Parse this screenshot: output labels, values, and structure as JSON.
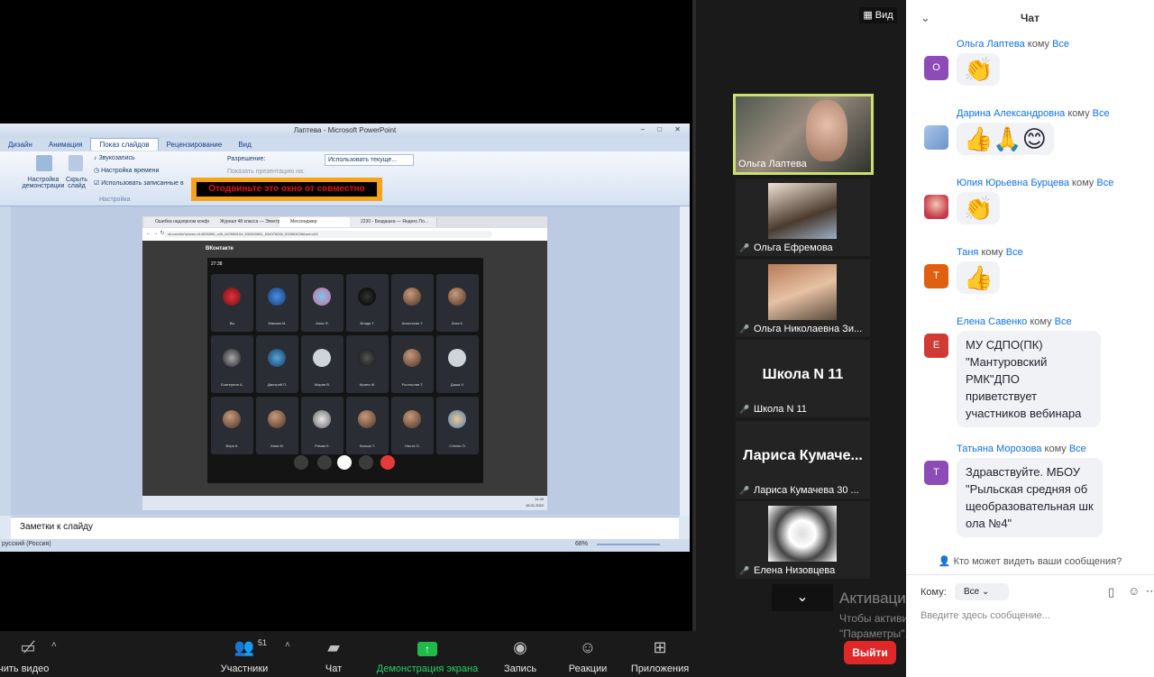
{
  "view_button": "Вид",
  "ppt": {
    "title": "Лаптева - Microsoft PowerPoint",
    "tabs": [
      "Дизайн",
      "Анимация",
      "Показ слайдов",
      "Рецензирование",
      "Вид"
    ],
    "active_tab": "Показ слайдов",
    "ribbon": {
      "setup_show": "Настройка демонстрации",
      "hide_slide": "Скрыть слайд",
      "record": "Звукозапись",
      "rehearse": "Настройка времени",
      "use_timings": "Использовать записанные в",
      "resolution_label": "Разрешение:",
      "resolution_value": "Использовать текуще...",
      "show_on": "Показать презентацию на:",
      "group_label": "Настройка"
    },
    "warning": "Отодвиньте это окно от совместно",
    "notes_placeholder": "Заметки к слайду",
    "status_lang": "русский (Россия)",
    "zoom": "68%"
  },
  "browser": {
    "tabs": [
      "Ошибка надзорном конфере...",
      "Журнал 48 класса — Электрон...",
      "Мессенджер",
      "2230 - Бездашка — Яндекс.По..."
    ],
    "active_tab": 2,
    "url": "vk.com/im?peers=c14526599_c45_547658104_532300591_534378245_533563028&sel=c53",
    "vk_logo": "ВКонтакте",
    "time": "27:38",
    "call_tiles": [
      "Вы",
      "Максим М.",
      "Анна Ф.",
      "Влада Т.",
      "Анастасия Т.",
      "Катя К.",
      "Екатерина А.",
      "Дмитрий П.",
      "Мария В.",
      "Ирина Ж.",
      "Ростислав Т.",
      "Даша Х.",
      "Вера К.",
      "Анна М.",
      "Роман К.",
      "Ксюша Т.",
      "Настя О.",
      "Степан П."
    ],
    "clock": "11:40",
    "date": "15.01.2022"
  },
  "gallery": {
    "tiles": [
      {
        "name": "Ольга Лаптева",
        "big": ""
      },
      {
        "name": "Ольга Ефремова",
        "big": ""
      },
      {
        "name": "Ольга Николаевна Зи...",
        "big": ""
      },
      {
        "name": "Школа N 11",
        "big": "Школа N 11"
      },
      {
        "name": "Лариса Кумачева 30 ...",
        "big": "Лариса  Кумаче..."
      },
      {
        "name": "Елена Низовцева",
        "big": ""
      }
    ]
  },
  "toolbar": {
    "video": "чить видео",
    "participants": "Участники",
    "participants_count": "51",
    "chat": "Чат",
    "share": "Демонстрация экрана",
    "record": "Запись",
    "reactions": "Реакции",
    "apps": "Приложения",
    "leave": "Выйти"
  },
  "watermark": {
    "line1": "Активация Windows",
    "line2": "Чтобы активировать Windows, перейдите в раздел \"Параметры\"."
  },
  "chat": {
    "title": "Чат",
    "messages": [
      {
        "sender": "Ольга Лаптева",
        "to_word": "кому",
        "to": "Все",
        "avatar": "О",
        "avatar_color": "#8c4bb7",
        "text": "👏"
      },
      {
        "sender": "Дарина Александровна",
        "to_word": "кому",
        "to": "Все",
        "avatar": "",
        "avatar_color": "#7fa7d8",
        "text": "👍🙏😊"
      },
      {
        "sender": "Юлия Юрьевна Бурцева",
        "to_word": "кому",
        "to": "Все",
        "avatar": "",
        "avatar_color": "#e0a3a3",
        "text": "👏"
      },
      {
        "sender": "Таня",
        "to_word": "кому",
        "to": "Все",
        "avatar": "Т",
        "avatar_color": "#e0600f",
        "text": "👍"
      },
      {
        "sender": "Елена Савенко",
        "to_word": "кому",
        "to": "Все",
        "avatar": "Е",
        "avatar_color": "#d13b36",
        "text": "МУ СДПО(ПК) \"Мантуровский РМК\"ДПО приветствует участников вебинара"
      },
      {
        "sender": "Татьяна Морозова",
        "to_word": "кому",
        "to": "Все",
        "avatar": "Т",
        "avatar_color": "#8c4bb7",
        "text": "Здравствуйте. МБОУ \"Рыльская средняя общеобразовательная школа №4\""
      }
    ],
    "who_can_see": "Кто может видеть ваши сообщения?",
    "to_label": "Кому:",
    "to_value": "Все",
    "input_placeholder": "Введите здесь сообщение..."
  }
}
